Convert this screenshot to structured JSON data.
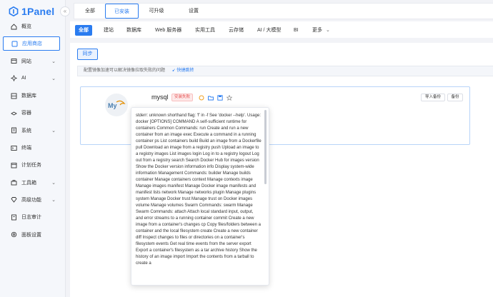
{
  "brand": {
    "name": "1Panel"
  },
  "sidebar": {
    "collapse_glyph": "«",
    "items": [
      {
        "label": "概览",
        "icon": "home-icon",
        "chevron": false
      },
      {
        "label": "应用商店",
        "icon": "store-icon",
        "chevron": false,
        "active": true
      },
      {
        "label": "网站",
        "icon": "globe-icon",
        "chevron": true
      },
      {
        "label": "AI",
        "icon": "ai-icon",
        "chevron": true
      },
      {
        "label": "数据库",
        "icon": "database-icon",
        "chevron": false
      },
      {
        "label": "容器",
        "icon": "container-icon",
        "chevron": false
      },
      {
        "label": "系统",
        "icon": "system-icon",
        "chevron": true
      },
      {
        "label": "终端",
        "icon": "terminal-icon",
        "chevron": false
      },
      {
        "label": "计划任务",
        "icon": "calendar-icon",
        "chevron": false
      },
      {
        "label": "工具箱",
        "icon": "toolbox-icon",
        "chevron": true
      },
      {
        "label": "高级功能",
        "icon": "diamond-icon",
        "chevron": true
      },
      {
        "label": "日志审计",
        "icon": "log-icon",
        "chevron": false
      },
      {
        "label": "面板设置",
        "icon": "settings-icon",
        "chevron": false
      }
    ],
    "chevron_glyph": "⌄"
  },
  "top_tabs": [
    {
      "label": "全部"
    },
    {
      "label": "已安装",
      "active": true
    },
    {
      "label": "可升级"
    },
    {
      "label": "设置"
    }
  ],
  "categories": [
    {
      "label": "全部",
      "active": true
    },
    {
      "label": "建站"
    },
    {
      "label": "数据库"
    },
    {
      "label": "Web 服务器"
    },
    {
      "label": "实用工具"
    },
    {
      "label": "云存储"
    },
    {
      "label": "AI / 大模型"
    },
    {
      "label": "BI"
    },
    {
      "label": "更多"
    }
  ],
  "content": {
    "sync_label": "同步",
    "notice_text": "配置镜像加速可以解决镜像拉取失败的问题",
    "notice_link": "快捷跳转",
    "app": {
      "name": "mysql",
      "status": "安装失败",
      "icon_text": "My",
      "import_backup_label": "导入备份",
      "backup_label": "备份"
    },
    "error_text": "stderr: unknown shorthand flag: 'f' in -f See 'docker --help'. Usage: docker [OPTIONS] COMMAND A self-sufficient runtime for containers Common Commands: run Create and run a new container from an image exec Execute a command in a running container ps List containers build Build an image from a Dockerfile pull Download an image from a registry push Upload an image to a registry images List images login Log in to a registry logout Log out from a registry search Search Docker Hub for images version Show the Docker version information info Display system-wide information Management Commands: builder Manage builds container Manage containers context Manage contexts image Manage images manifest Manage Docker image manifests and manifest lists network Manage networks plugin Manage plugins system Manage Docker trust Manage trust on Docker images volume Manage volumes Swarm Commands: swarm Manage Swarm Commands: attach Attach local standard input, output, and error streams to a running container commit Create a new image from a container's changes cp Copy files/folders between a container and the local filesystem create Create a new container diff Inspect changes to files or directories on a container's filesystem events Get real time events from the server export Export a container's filesystem as a tar archive history Show the history of an image import Import the contents from a tarball to create a"
  },
  "colors": {
    "accent": "#2a7cf0",
    "danger": "#e55353"
  }
}
